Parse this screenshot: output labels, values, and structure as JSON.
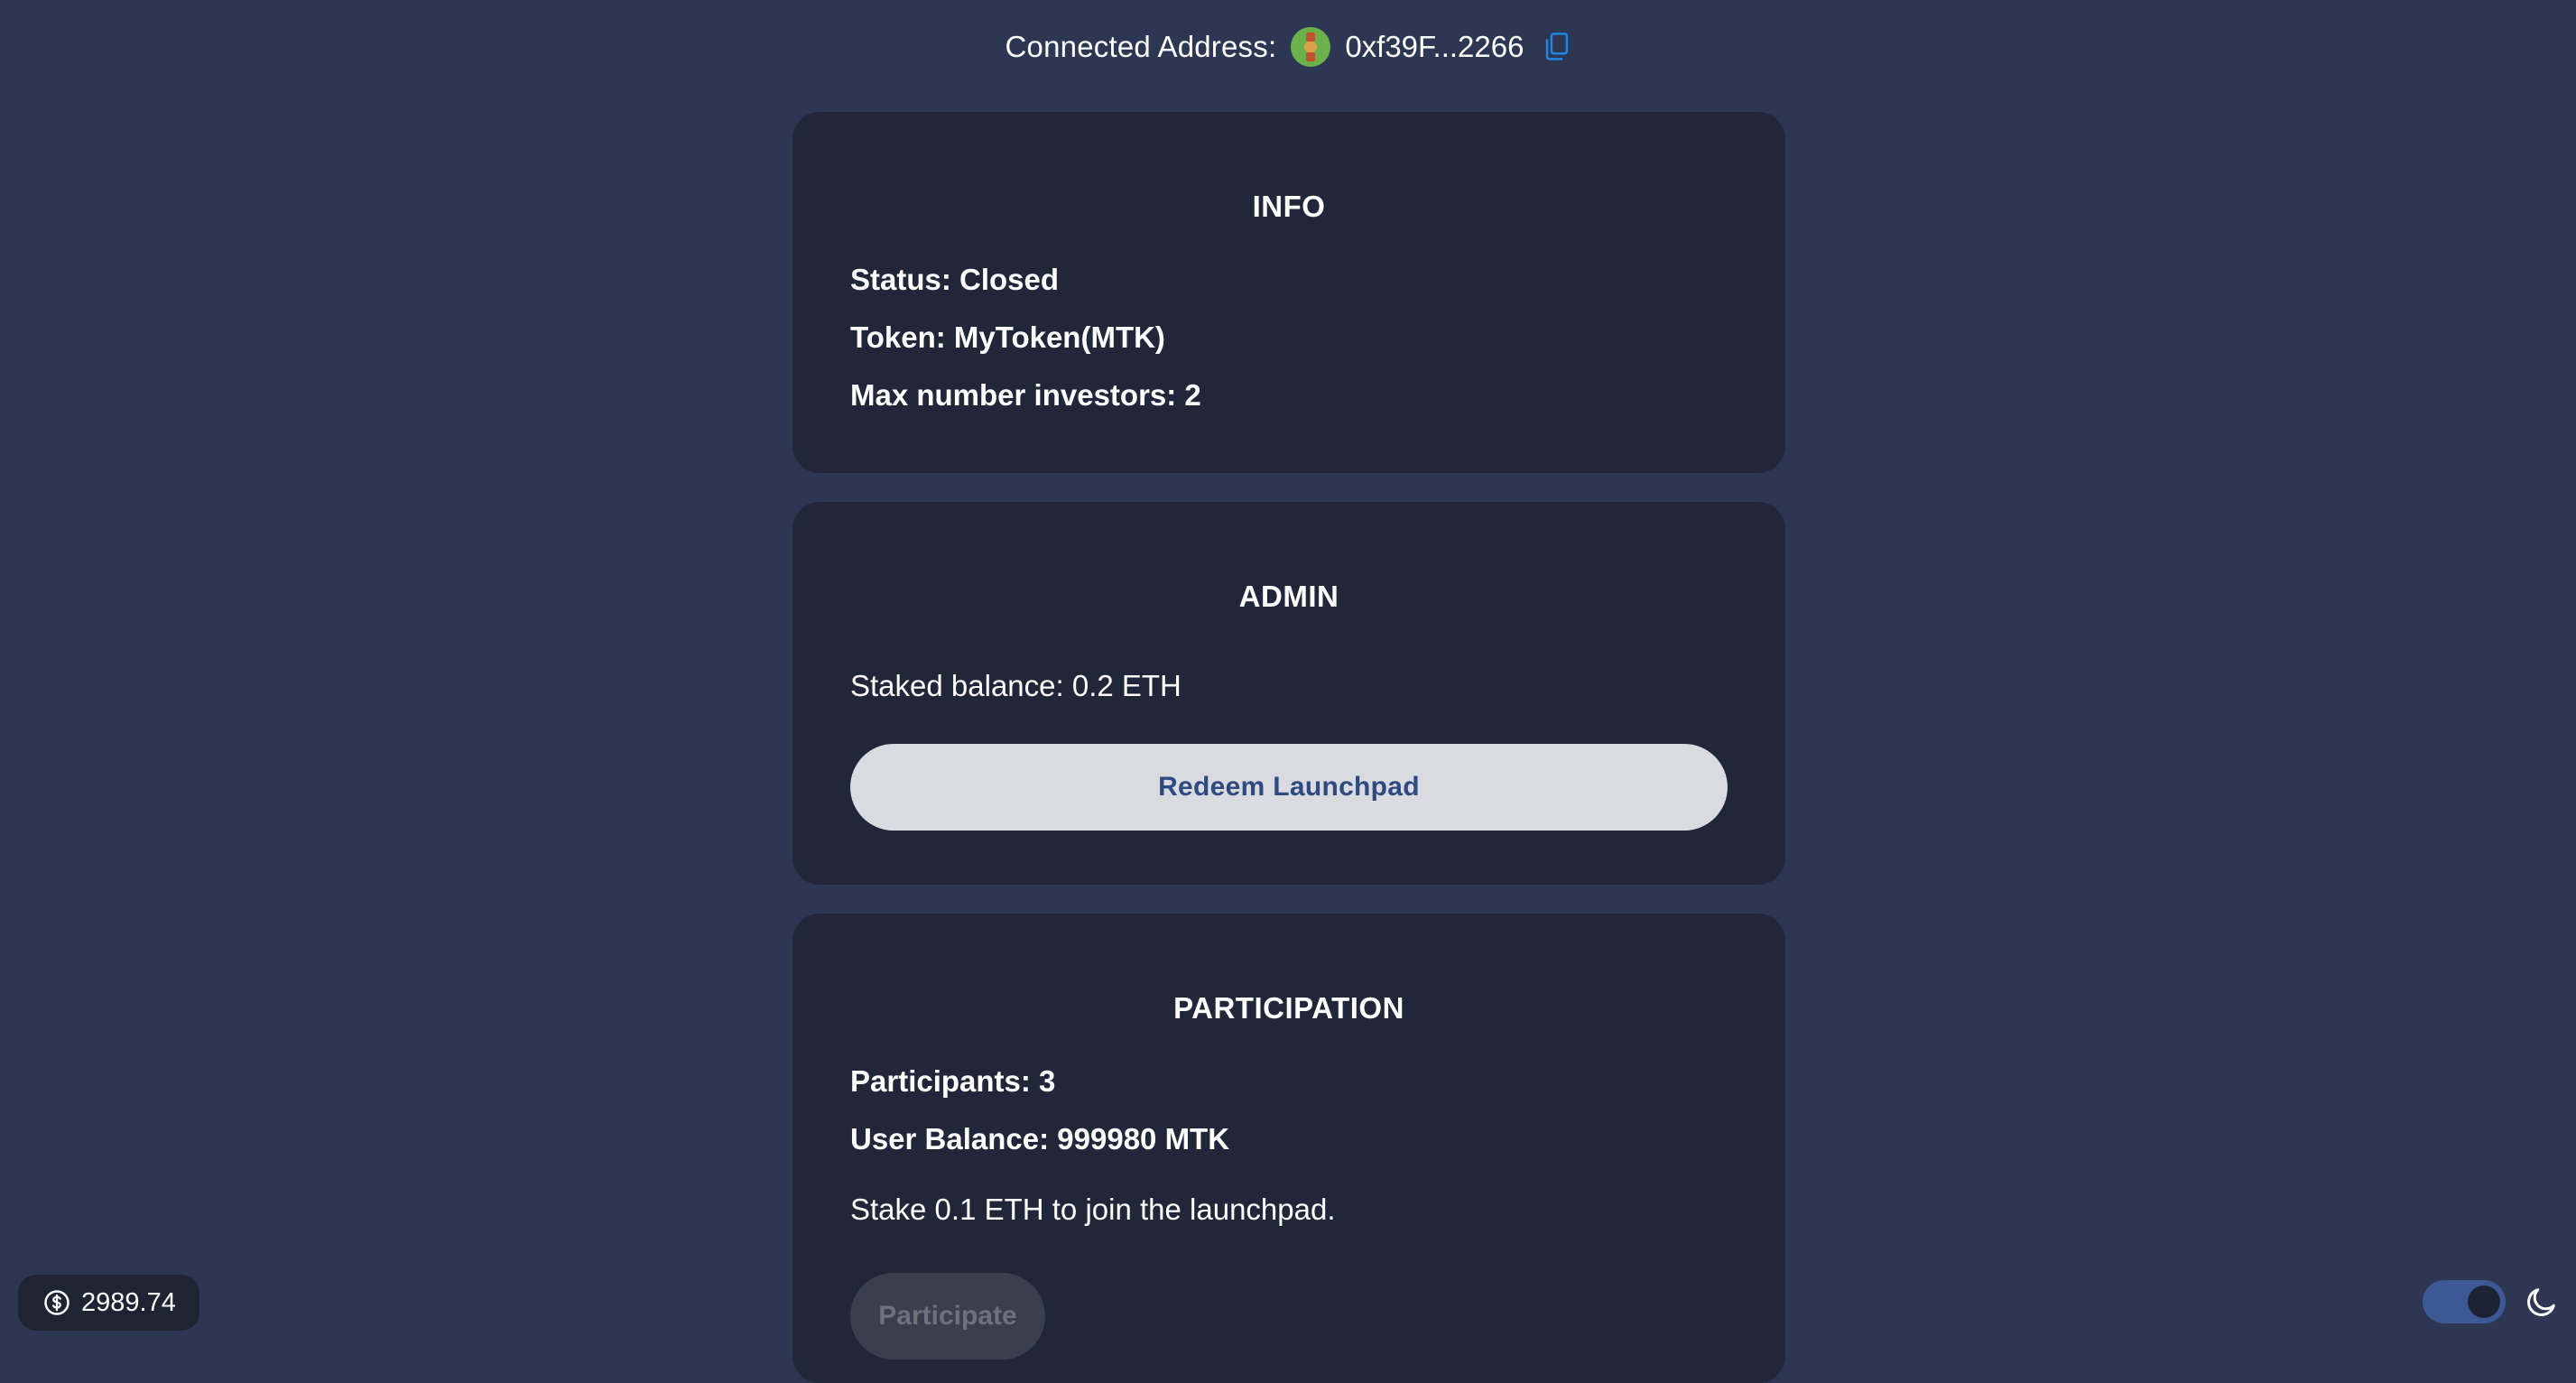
{
  "header": {
    "connected_label": "Connected Address:",
    "address": "0xf39F...2266",
    "avatar_icon": "identicon-avatar",
    "copy_icon": "copy-icon"
  },
  "info": {
    "title": "INFO",
    "status": "Status: Closed",
    "token": "Token: MyToken(MTK)",
    "max_investors": "Max number investors: 2"
  },
  "admin": {
    "title": "ADMIN",
    "staked_balance": "Staked balance: 0.2 ETH",
    "redeem_label": "Redeem Launchpad"
  },
  "participation": {
    "title": "PARTICIPATION",
    "participants": "Participants: 3",
    "user_balance": "User Balance: 999980 MTK",
    "stake_text": "Stake 0.1 ETH to join the launchpad.",
    "participate_label": "Participate"
  },
  "footer": {
    "eth_price": "2989.74",
    "price_icon": "dollar-circle-icon",
    "theme_icon": "moon-icon",
    "dark_mode_on": true
  },
  "colors": {
    "background": "#2d3754",
    "card": "#212639",
    "accent": "#3c5996",
    "button_text": "#2e4a80"
  }
}
